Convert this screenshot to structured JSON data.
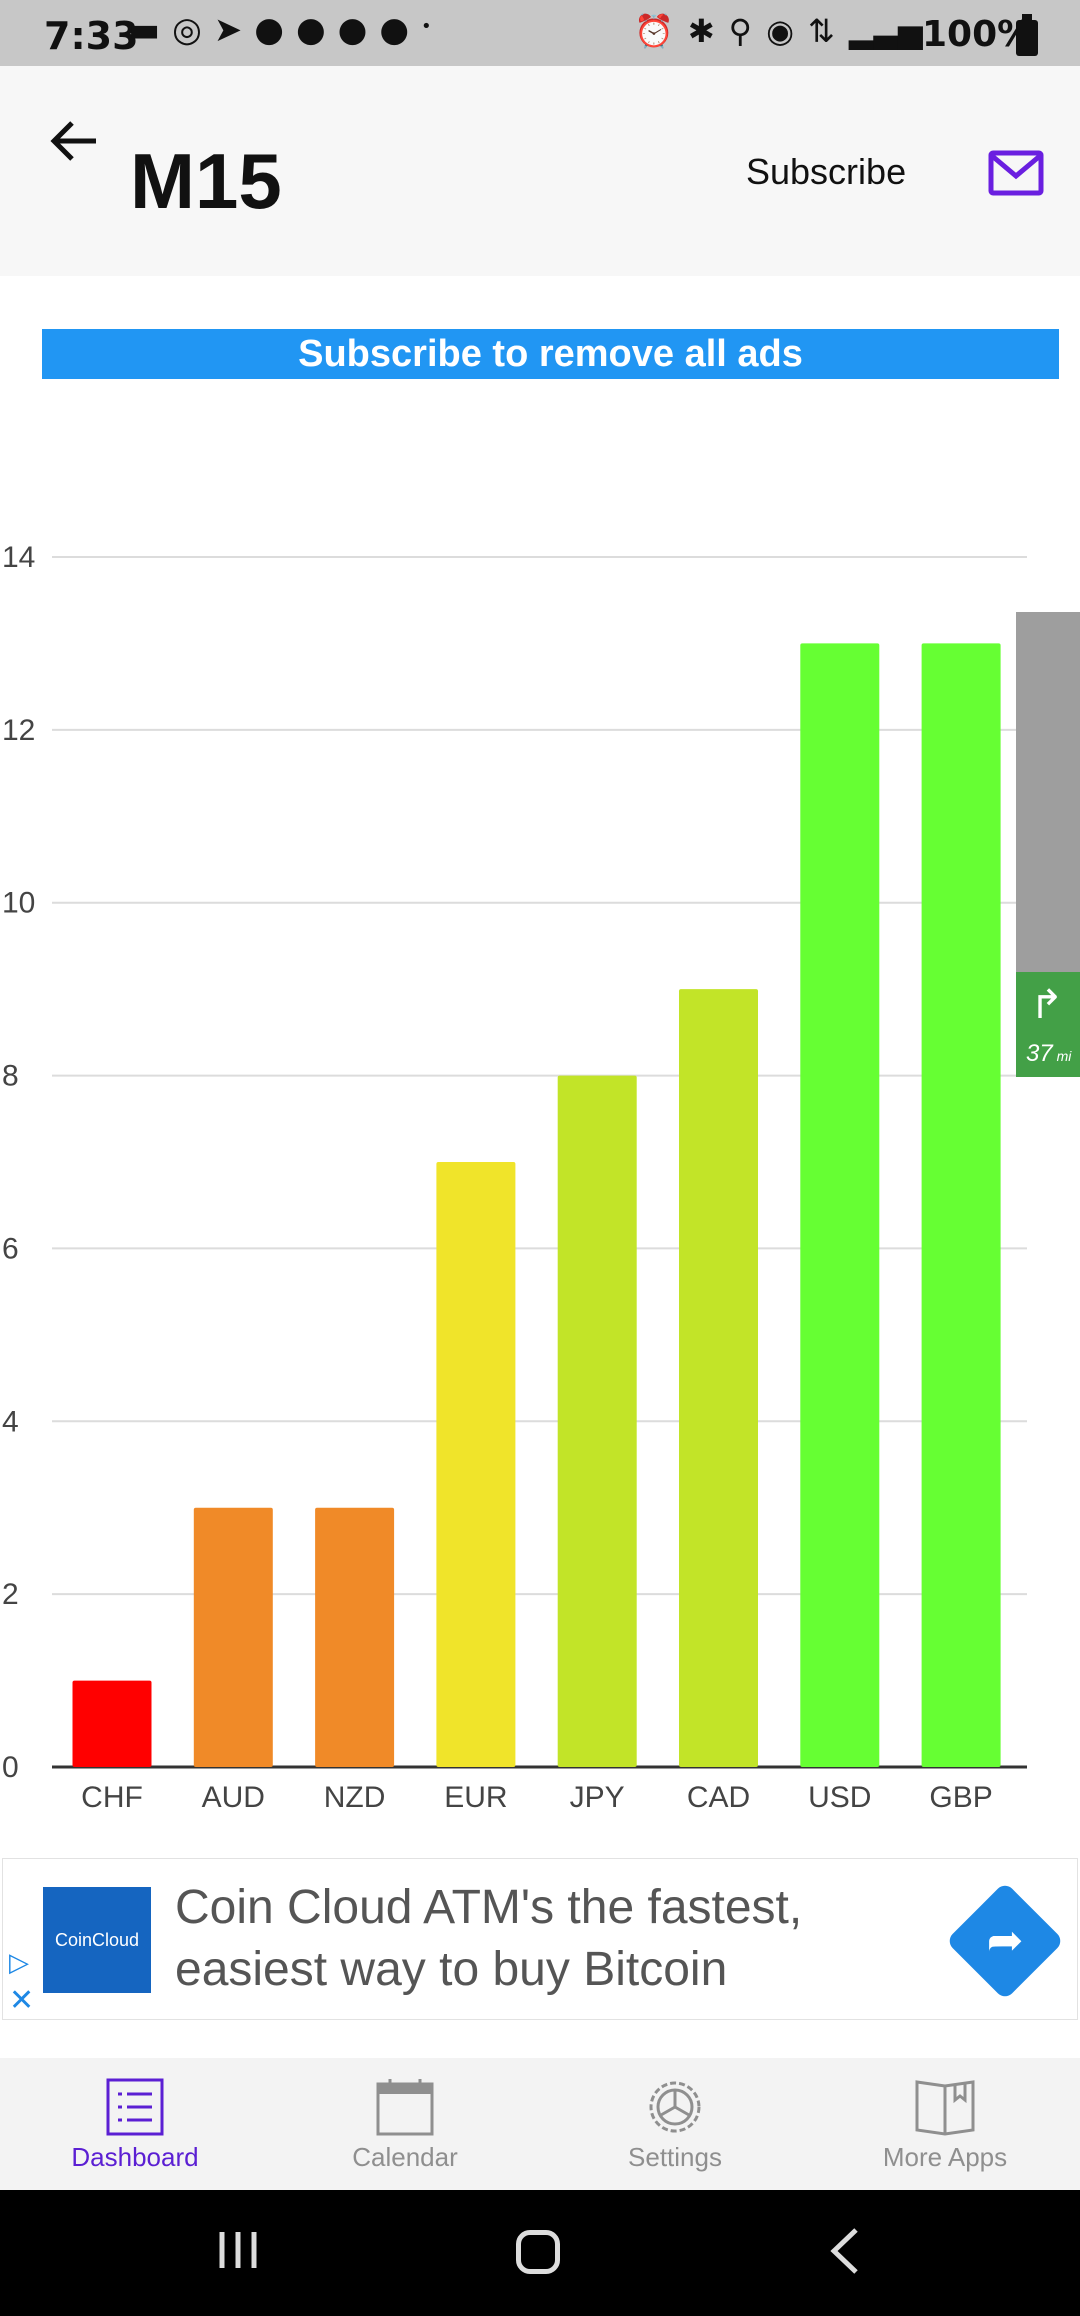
{
  "status_bar": {
    "time": "7:33",
    "battery": "100%",
    "notif_icons": [
      "message-icon",
      "whatsapp-icon",
      "telegram-icon",
      "discord-icon",
      "discord-icon",
      "discord-icon",
      "discord-icon",
      "dot-icon"
    ],
    "sys_icons": [
      "alarm-icon",
      "bluetooth-icon",
      "location-icon",
      "hotspot-icon",
      "data-icon",
      "signal-icon"
    ]
  },
  "header": {
    "title": "M15",
    "subscribe_label": "Subscribe"
  },
  "banner": {
    "text": "Subscribe to remove all ads"
  },
  "chart_data": {
    "type": "bar",
    "categories": [
      "CHF",
      "AUD",
      "NZD",
      "EUR",
      "JPY",
      "CAD",
      "USD",
      "GBP"
    ],
    "values": [
      1,
      3,
      3,
      7,
      8,
      9,
      13,
      13
    ],
    "colors": [
      "#ff0000",
      "#f08a28",
      "#f08a28",
      "#f0e42a",
      "#c2e428",
      "#c2e428",
      "#66ff33",
      "#66ff33"
    ],
    "ylim": [
      0,
      14
    ],
    "yticks": [
      "0",
      "2",
      "4",
      "6",
      "8",
      "10",
      "12",
      "14"
    ],
    "grid": true
  },
  "nav_overlay": {
    "distance": "37",
    "unit": "mi"
  },
  "ad": {
    "brand": "CoinCloud",
    "text": "Coin Cloud ATM's the fastest, easiest way to buy Bitcoin"
  },
  "bottom_nav": {
    "items": [
      {
        "label": "Dashboard"
      },
      {
        "label": "Calendar"
      },
      {
        "label": "Settings"
      },
      {
        "label": "More Apps"
      }
    ]
  }
}
